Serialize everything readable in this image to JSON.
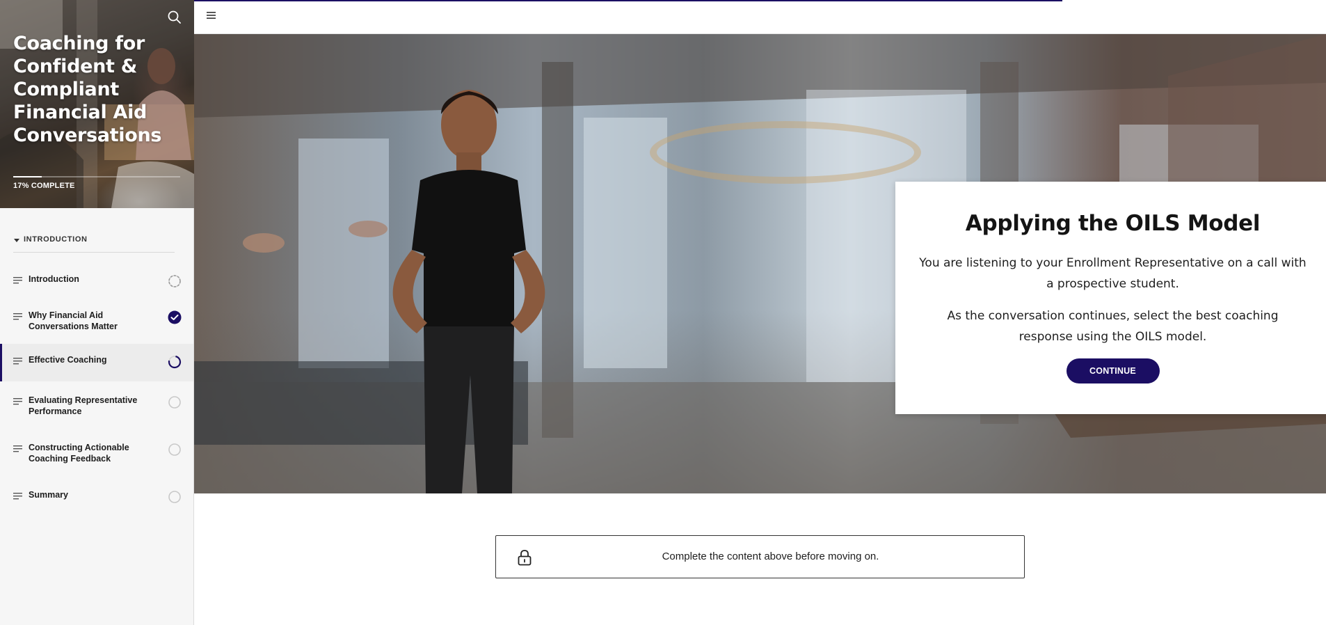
{
  "sidebar": {
    "course_title": "Coaching for Confident & Compliant Financial Aid Conversations",
    "progress_label": "17% COMPLETE",
    "progress_fraction": 0.17,
    "section_label": "INTRODUCTION",
    "lessons": [
      {
        "label": "Introduction",
        "status": "in-progress",
        "active": false
      },
      {
        "label": "Why Financial Aid Conversations Matter",
        "status": "complete",
        "active": false
      },
      {
        "label": "Effective Coaching",
        "status": "in-progress",
        "active": true
      },
      {
        "label": "Evaluating Representative Performance",
        "status": "not-started",
        "active": false
      },
      {
        "label": "Constructing Actionable Coaching Feedback",
        "status": "not-started",
        "active": false
      },
      {
        "label": "Summary",
        "status": "not-started",
        "active": false
      }
    ]
  },
  "main": {
    "modal": {
      "title": "Applying the OILS Model",
      "paragraph1": "You are listening to your Enrollment Representative on a call with a prospective student.",
      "paragraph2": "As the conversation continues, select the best coaching response using the OILS model.",
      "continue_label": "CONTINUE"
    },
    "lock_message": "Complete the content above before moving on."
  },
  "colors": {
    "accent": "#1b0e63",
    "sidebar_bg": "#f6f6f6"
  },
  "icons": {
    "search": "search-icon",
    "menu": "hamburger-menu-icon",
    "lesson": "lines-icon",
    "lock": "lock-icon"
  }
}
